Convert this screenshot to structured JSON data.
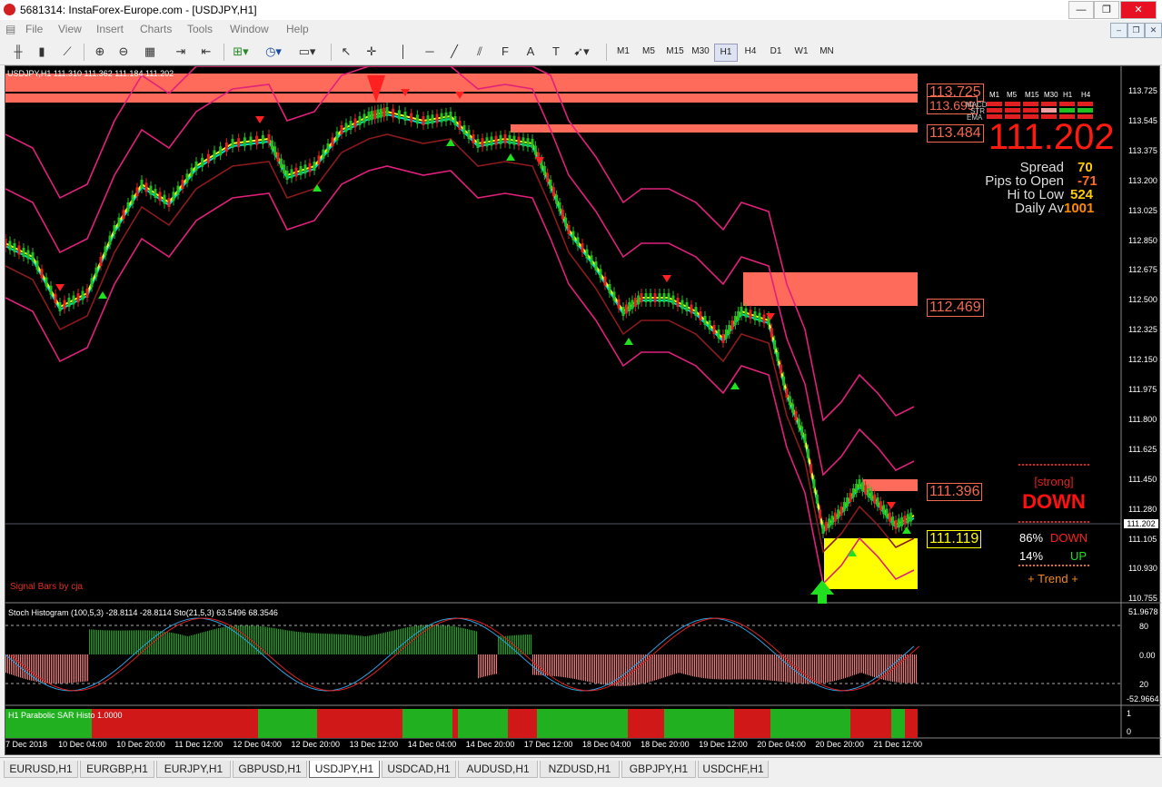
{
  "window": {
    "title": "5681314: InstaForex-Europe.com - [USDJPY,H1]"
  },
  "menu": [
    "File",
    "View",
    "Insert",
    "Charts",
    "Tools",
    "Window",
    "Help"
  ],
  "timeframes": [
    "M1",
    "M5",
    "M15",
    "M30",
    "H1",
    "H4",
    "D1",
    "W1",
    "MN"
  ],
  "active_timeframe": "H1",
  "chart": {
    "header": "USDJPY,H1  111.310 111.362 111.184 111.202",
    "signal_bars_label": "Signal Bars by cja",
    "price_axis": [
      "113.725",
      "113.545",
      "113.375",
      "113.200",
      "113.025",
      "112.850",
      "112.675",
      "112.500",
      "112.325",
      "112.150",
      "111.975",
      "111.800",
      "111.625",
      "111.450",
      "111.280",
      "111.105",
      "110.930",
      "110.755"
    ],
    "current_price_tag": "111.202",
    "levels": [
      {
        "value": "113.725",
        "color": "#f06a50"
      },
      {
        "value": "113.699",
        "color": "#f06a50"
      },
      {
        "value": "113.484",
        "color": "#f06a50"
      },
      {
        "value": "112.469",
        "color": "#f06a50"
      },
      {
        "value": "111.396",
        "color": "#f06a50"
      },
      {
        "value": "111.119",
        "color": "#ffff00"
      }
    ],
    "time_axis": [
      "7 Dec 2018",
      "10 Dec 04:00",
      "10 Dec 20:00",
      "11 Dec 12:00",
      "12 Dec 04:00",
      "12 Dec 20:00",
      "13 Dec 12:00",
      "14 Dec 04:00",
      "14 Dec 20:00",
      "17 Dec 12:00",
      "18 Dec 04:00",
      "18 Dec 20:00",
      "19 Dec 12:00",
      "20 Dec 04:00",
      "20 Dec 20:00",
      "21 Dec 12:00"
    ]
  },
  "info_panel": {
    "tf_headers": [
      "M1",
      "M5",
      "M15",
      "M30",
      "H1",
      "H4"
    ],
    "row_labels": [
      "MACD",
      "STR",
      "EMA"
    ],
    "price": "111.202",
    "stats": [
      {
        "label": "Spread",
        "value": "70",
        "color": "#ffcc00"
      },
      {
        "label": "Pips to Open",
        "value": "-71",
        "color": "#ff6a20"
      },
      {
        "label": "Hi to Low",
        "value": "524",
        "color": "#ffcc00"
      },
      {
        "label": "Daily Av",
        "value": "1001",
        "color": "#ff8a00"
      }
    ]
  },
  "trend_panel": {
    "strength": "[strong]",
    "direction": "DOWN",
    "down_pct": "86%",
    "down_label": "DOWN",
    "up_pct": "14%",
    "up_label": "UP",
    "footer": "+   Trend   +"
  },
  "stoch": {
    "header": "Stoch Histogram (100,5,3) -28.8114 -28.8114  Sto(21,5,3) 63.5496 68.3546",
    "scale": [
      "51.9678",
      "80",
      "0.00",
      "20",
      "-52.9664"
    ]
  },
  "sar": {
    "header": "H1 Parabolic SAR Histo 1.0000",
    "scale": [
      "1",
      "0"
    ],
    "segments": [
      "g",
      "r",
      "g",
      "r",
      "g",
      "r",
      "g",
      "r",
      "g",
      "r",
      "g",
      "r",
      "g",
      "r",
      "g",
      "r",
      "g"
    ]
  },
  "tabs": [
    "EURUSD,H1",
    "EURGBP,H1",
    "EURJPY,H1",
    "GBPUSD,H1",
    "USDJPY,H1",
    "USDCAD,H1",
    "AUDUSD,H1",
    "NZDUSD,H1",
    "GBPJPY,H1",
    "USDCHF,H1"
  ],
  "active_tab": "USDJPY,H1"
}
